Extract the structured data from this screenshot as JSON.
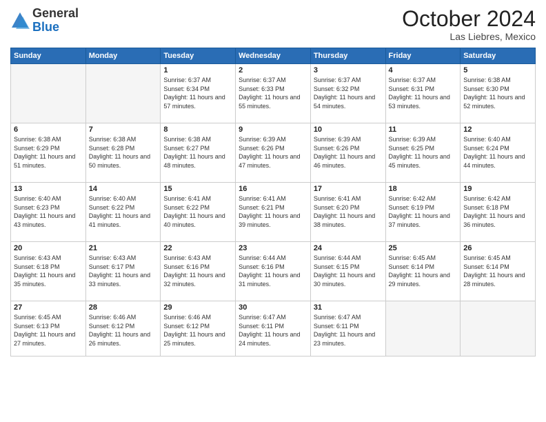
{
  "logo": {
    "general": "General",
    "blue": "Blue"
  },
  "title": "October 2024",
  "location": "Las Liebres, Mexico",
  "days_header": [
    "Sunday",
    "Monday",
    "Tuesday",
    "Wednesday",
    "Thursday",
    "Friday",
    "Saturday"
  ],
  "weeks": [
    [
      {
        "day": "",
        "info": ""
      },
      {
        "day": "",
        "info": ""
      },
      {
        "day": "1",
        "info": "Sunrise: 6:37 AM\nSunset: 6:34 PM\nDaylight: 11 hours and 57 minutes."
      },
      {
        "day": "2",
        "info": "Sunrise: 6:37 AM\nSunset: 6:33 PM\nDaylight: 11 hours and 55 minutes."
      },
      {
        "day": "3",
        "info": "Sunrise: 6:37 AM\nSunset: 6:32 PM\nDaylight: 11 hours and 54 minutes."
      },
      {
        "day": "4",
        "info": "Sunrise: 6:37 AM\nSunset: 6:31 PM\nDaylight: 11 hours and 53 minutes."
      },
      {
        "day": "5",
        "info": "Sunrise: 6:38 AM\nSunset: 6:30 PM\nDaylight: 11 hours and 52 minutes."
      }
    ],
    [
      {
        "day": "6",
        "info": "Sunrise: 6:38 AM\nSunset: 6:29 PM\nDaylight: 11 hours and 51 minutes."
      },
      {
        "day": "7",
        "info": "Sunrise: 6:38 AM\nSunset: 6:28 PM\nDaylight: 11 hours and 50 minutes."
      },
      {
        "day": "8",
        "info": "Sunrise: 6:38 AM\nSunset: 6:27 PM\nDaylight: 11 hours and 48 minutes."
      },
      {
        "day": "9",
        "info": "Sunrise: 6:39 AM\nSunset: 6:26 PM\nDaylight: 11 hours and 47 minutes."
      },
      {
        "day": "10",
        "info": "Sunrise: 6:39 AM\nSunset: 6:26 PM\nDaylight: 11 hours and 46 minutes."
      },
      {
        "day": "11",
        "info": "Sunrise: 6:39 AM\nSunset: 6:25 PM\nDaylight: 11 hours and 45 minutes."
      },
      {
        "day": "12",
        "info": "Sunrise: 6:40 AM\nSunset: 6:24 PM\nDaylight: 11 hours and 44 minutes."
      }
    ],
    [
      {
        "day": "13",
        "info": "Sunrise: 6:40 AM\nSunset: 6:23 PM\nDaylight: 11 hours and 43 minutes."
      },
      {
        "day": "14",
        "info": "Sunrise: 6:40 AM\nSunset: 6:22 PM\nDaylight: 11 hours and 41 minutes."
      },
      {
        "day": "15",
        "info": "Sunrise: 6:41 AM\nSunset: 6:22 PM\nDaylight: 11 hours and 40 minutes."
      },
      {
        "day": "16",
        "info": "Sunrise: 6:41 AM\nSunset: 6:21 PM\nDaylight: 11 hours and 39 minutes."
      },
      {
        "day": "17",
        "info": "Sunrise: 6:41 AM\nSunset: 6:20 PM\nDaylight: 11 hours and 38 minutes."
      },
      {
        "day": "18",
        "info": "Sunrise: 6:42 AM\nSunset: 6:19 PM\nDaylight: 11 hours and 37 minutes."
      },
      {
        "day": "19",
        "info": "Sunrise: 6:42 AM\nSunset: 6:18 PM\nDaylight: 11 hours and 36 minutes."
      }
    ],
    [
      {
        "day": "20",
        "info": "Sunrise: 6:43 AM\nSunset: 6:18 PM\nDaylight: 11 hours and 35 minutes."
      },
      {
        "day": "21",
        "info": "Sunrise: 6:43 AM\nSunset: 6:17 PM\nDaylight: 11 hours and 33 minutes."
      },
      {
        "day": "22",
        "info": "Sunrise: 6:43 AM\nSunset: 6:16 PM\nDaylight: 11 hours and 32 minutes."
      },
      {
        "day": "23",
        "info": "Sunrise: 6:44 AM\nSunset: 6:16 PM\nDaylight: 11 hours and 31 minutes."
      },
      {
        "day": "24",
        "info": "Sunrise: 6:44 AM\nSunset: 6:15 PM\nDaylight: 11 hours and 30 minutes."
      },
      {
        "day": "25",
        "info": "Sunrise: 6:45 AM\nSunset: 6:14 PM\nDaylight: 11 hours and 29 minutes."
      },
      {
        "day": "26",
        "info": "Sunrise: 6:45 AM\nSunset: 6:14 PM\nDaylight: 11 hours and 28 minutes."
      }
    ],
    [
      {
        "day": "27",
        "info": "Sunrise: 6:45 AM\nSunset: 6:13 PM\nDaylight: 11 hours and 27 minutes."
      },
      {
        "day": "28",
        "info": "Sunrise: 6:46 AM\nSunset: 6:12 PM\nDaylight: 11 hours and 26 minutes."
      },
      {
        "day": "29",
        "info": "Sunrise: 6:46 AM\nSunset: 6:12 PM\nDaylight: 11 hours and 25 minutes."
      },
      {
        "day": "30",
        "info": "Sunrise: 6:47 AM\nSunset: 6:11 PM\nDaylight: 11 hours and 24 minutes."
      },
      {
        "day": "31",
        "info": "Sunrise: 6:47 AM\nSunset: 6:11 PM\nDaylight: 11 hours and 23 minutes."
      },
      {
        "day": "",
        "info": ""
      },
      {
        "day": "",
        "info": ""
      }
    ]
  ]
}
